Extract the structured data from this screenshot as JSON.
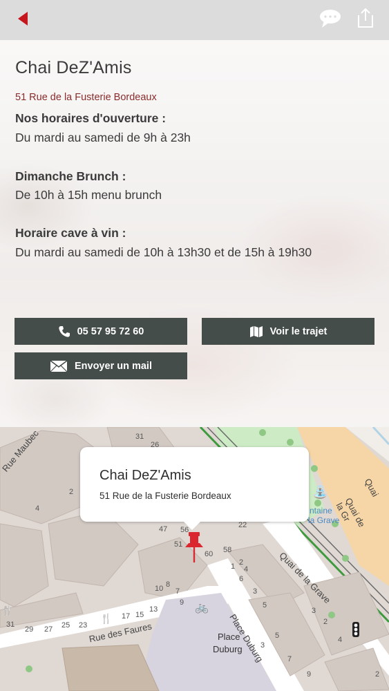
{
  "header": {
    "back_icon": "back-arrow-icon",
    "chat_icon": "speech-bubble-icon",
    "share_icon": "share-icon"
  },
  "place": {
    "name": "Chai DeZ'Amis",
    "address": "51 Rue de la Fusterie Bordeaux"
  },
  "hours": [
    {
      "heading": "Nos horaires d'ouverture :",
      "text": "Du mardi au samedi de 9h à 23h"
    },
    {
      "heading": "Dimanche Brunch :",
      "text": "De 10h à 15h menu brunch"
    },
    {
      "heading": "Horaire cave à vin :",
      "text": "Du mardi au samedi de 10h à 13h30 et de 15h à 19h30"
    }
  ],
  "actions": {
    "phone_label": "05 57 95 72 60",
    "route_label": "Voir le trajet",
    "mail_label": "Envoyer un mail"
  },
  "map": {
    "callout_title": "Chai DeZ'Amis",
    "callout_address": "51 Rue de la Fusterie Bordeaux",
    "street_labels": [
      "Rue Maubec",
      "Rue des Faures",
      "Place Duburg",
      "Quai de la Grave",
      "Quai de la Gr",
      "Quai"
    ],
    "place_label_1": "Place",
    "place_label_2": "Duburg",
    "poi_label_1": "ntaine",
    "poi_label_2": "la Grave",
    "house_numbers": [
      "31",
      "26",
      "4",
      "2",
      "22",
      "47",
      "56",
      "51",
      "60",
      "58",
      "1",
      "2",
      "4",
      "6",
      "3",
      "5",
      "8",
      "10",
      "7",
      "9",
      "13",
      "17",
      "15",
      "25",
      "23",
      "27",
      "29",
      "31",
      "3",
      "5",
      "7",
      "9",
      "3",
      "2",
      "4",
      "2"
    ],
    "colors": {
      "pin": "#d9262f",
      "quay": "#f6d6a6",
      "park": "#cdebc5",
      "water": "#b2d3e6",
      "square": "#d7d4e0"
    }
  }
}
